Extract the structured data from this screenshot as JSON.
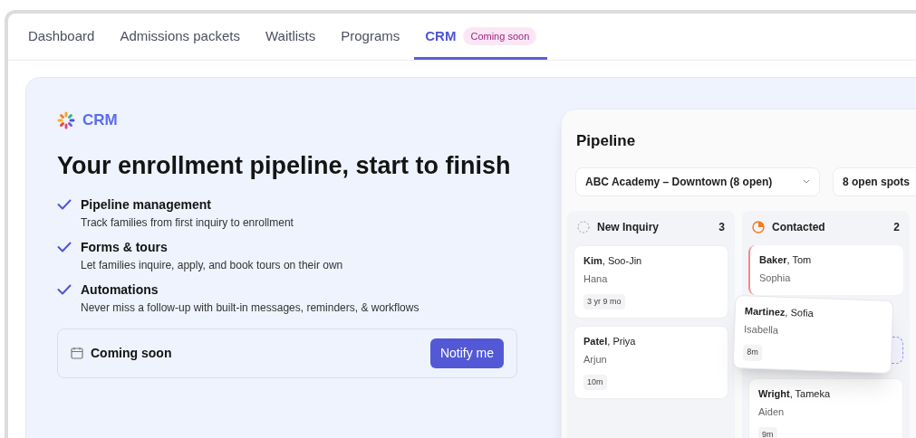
{
  "tabs": [
    {
      "label": "Dashboard",
      "selected": false
    },
    {
      "label": "Admissions packets",
      "selected": false
    },
    {
      "label": "Waitlists",
      "selected": false
    },
    {
      "label": "Programs",
      "selected": false
    },
    {
      "label": "CRM",
      "selected": true,
      "badge": "Coming soon"
    }
  ],
  "hero": {
    "brand": "CRM",
    "heading": "Your enrollment pipeline, start to finish",
    "features": [
      {
        "title": "Pipeline management",
        "description": "Track families from first inquiry to enrollment"
      },
      {
        "title": "Forms & tours",
        "description": "Let families inquire, apply, and book tours on their own"
      },
      {
        "title": "Automations",
        "description": "Never miss a follow-up with built-in messages, reminders, & workflows"
      }
    ],
    "notice": {
      "label": "Coming soon",
      "button": "Notify me"
    }
  },
  "pipeline": {
    "title": "Pipeline",
    "filters": [
      "ABC Academy – Downtown (8 open)",
      "8 open spots"
    ],
    "columns": [
      {
        "name": "New Inquiry",
        "count": "3",
        "kind": "new",
        "drop_target": false,
        "cards": [
          {
            "family": "**Kim**, Soo-Jin",
            "child": "Hana",
            "tag": "3 yr 9 mo",
            "flagged": false
          },
          {
            "family": "**Patel**, Priya",
            "child": "Arjun",
            "tag": "10m",
            "flagged": false
          }
        ]
      },
      {
        "name": "Contacted",
        "count": "2",
        "kind": "contacted",
        "drop_target": true,
        "cards": [
          {
            "family": "**Baker**, Tom",
            "child": "Sophia",
            "flagged": true
          },
          {
            "family": "**Wright**, Tameka",
            "child": "Aiden",
            "tag": "9m",
            "flagged": false
          }
        ]
      }
    ],
    "dragged_card": {
      "family": "**Martinez**, Sofia",
      "child": "Isabella",
      "tag": "8m"
    }
  }
}
